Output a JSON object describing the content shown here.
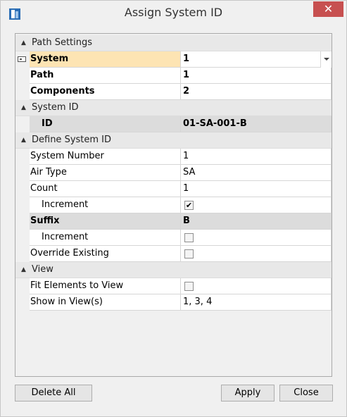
{
  "window": {
    "title": "Assign System ID",
    "close_glyph": "✕"
  },
  "grid": {
    "path_settings": {
      "label": "Path Settings",
      "rows": {
        "system": {
          "name": "System",
          "value": "1"
        },
        "path": {
          "name": "Path",
          "value": "1"
        },
        "components": {
          "name": "Components",
          "value": "2"
        }
      }
    },
    "system_id": {
      "label": "System ID",
      "rows": {
        "id": {
          "name": "ID",
          "value": "01-SA-001-B"
        }
      }
    },
    "define_system_id": {
      "label": "Define System ID",
      "rows": {
        "system_number": {
          "name": "System Number",
          "value": "1"
        },
        "air_type": {
          "name": "Air Type",
          "value": "SA"
        },
        "count": {
          "name": "Count",
          "value": "1"
        },
        "count_increment": {
          "name": "Increment",
          "checked": true,
          "check_glyph": "✔"
        },
        "suffix": {
          "name": "Suffix",
          "value": "B"
        },
        "suffix_increment": {
          "name": "Increment",
          "checked": false
        },
        "override_existing": {
          "name": "Override Existing",
          "checked": false
        }
      }
    },
    "view": {
      "label": "View",
      "rows": {
        "fit_elements": {
          "name": "Fit Elements to View",
          "checked": false
        },
        "show_in_views": {
          "name": "Show in View(s)",
          "value": "1, 3, 4"
        }
      }
    }
  },
  "buttons": {
    "delete_all": "Delete All",
    "apply": "Apply",
    "close": "Close"
  },
  "colors": {
    "close_button": "#c75050",
    "selected_row": "#fde4b3",
    "readonly_row": "#dcdcdc"
  }
}
